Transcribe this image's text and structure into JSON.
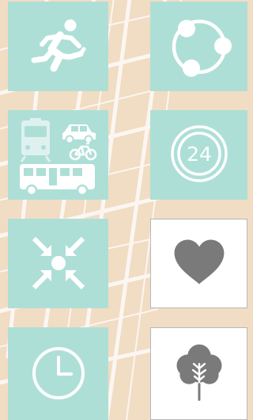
{
  "colors": {
    "map_background": "#f1dcc4",
    "map_roads": "#fbf6f1",
    "teal_tile": "#aedfd7",
    "white_tile": "#ffffff",
    "icon_light": "#ffffff",
    "icon_dark": "#7a7a7a"
  },
  "tiles": [
    {
      "name": "running-tile",
      "icon": "running-person-icon"
    },
    {
      "name": "network-tile",
      "icon": "network-share-icon"
    },
    {
      "name": "transport-tile",
      "icon": "transport-modes-icon"
    },
    {
      "name": "24-hours-tile",
      "icon": "clock-24-icon",
      "label": "24"
    },
    {
      "name": "centralize-tile",
      "icon": "arrows-inward-icon"
    },
    {
      "name": "favorite-tile",
      "icon": "heart-icon"
    },
    {
      "name": "time-tile",
      "icon": "clock-icon"
    },
    {
      "name": "nature-tile",
      "icon": "tree-icon"
    }
  ]
}
